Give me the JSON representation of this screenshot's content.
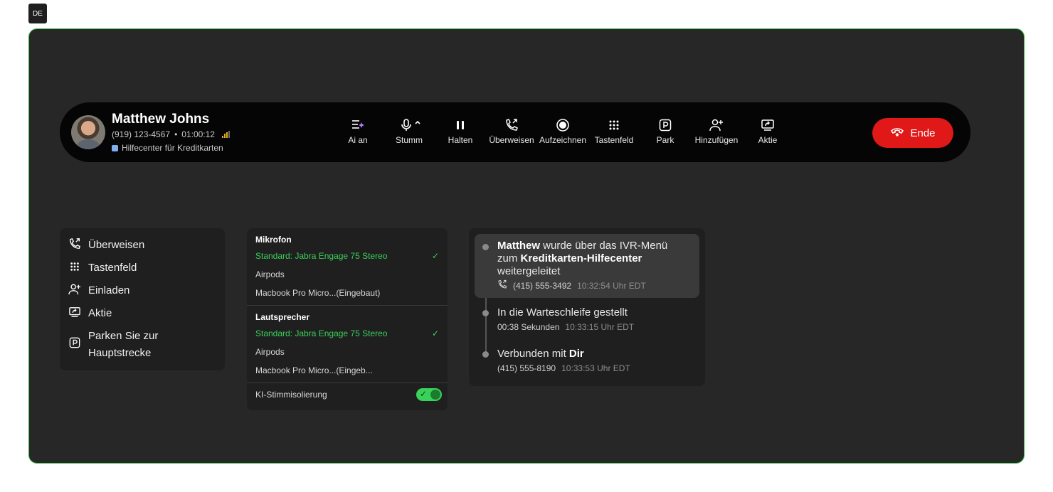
{
  "lang_badge": "DE",
  "caller": {
    "name": "Matthew Johns",
    "phone": "(919) 123-4567",
    "separator": "•",
    "duration": "01:00:12",
    "queue": "Hilfecenter für Kreditkarten"
  },
  "controls": [
    {
      "label": "Ai an",
      "icon": "ai-icon"
    },
    {
      "label": "Stumm",
      "icon": "microphone-icon"
    },
    {
      "label": "Halten",
      "icon": "pause-icon"
    },
    {
      "label": "Überweisen",
      "icon": "transfer-icon"
    },
    {
      "label": "Aufzeichnen",
      "icon": "record-icon"
    },
    {
      "label": "Tastenfeld",
      "icon": "keypad-icon"
    },
    {
      "label": "Park",
      "icon": "park-icon"
    },
    {
      "label": "Hinzufügen",
      "icon": "add-person-icon"
    },
    {
      "label": "Aktie",
      "icon": "share-screen-icon"
    }
  ],
  "end_button": {
    "label": "Ende",
    "color": "#e01818"
  },
  "menu": {
    "items": [
      {
        "label": "Überweisen",
        "icon": "transfer-icon"
      },
      {
        "label": "Tastenfeld",
        "icon": "keypad-icon"
      },
      {
        "label": "Einladen",
        "icon": "add-person-icon"
      },
      {
        "label": "Aktie",
        "icon": "share-screen-icon"
      },
      {
        "label_line1": "Parken Sie zur",
        "label_line2": "Hauptstrecke",
        "icon": "park-icon"
      }
    ]
  },
  "audio": {
    "mic_header": "Mikrofon",
    "mic_options": [
      "Standard: Jabra Engage 75 Stereo",
      "Airpods",
      "Macbook Pro Micro...(Eingebaut)"
    ],
    "speaker_header": "Lautsprecher",
    "speaker_options": [
      "Standard: Jabra Engage 75 Stereo",
      "Airpods",
      "Macbook Pro Micro...(Eingeb..."
    ],
    "isolation_label": "KI-Stimmisolierung",
    "isolation_on": true,
    "selected_color": "#3ad15a"
  },
  "timeline": {
    "event1": {
      "bold1": "Matthew",
      "text1": " wurde über das IVR-Menü zum ",
      "bold2": "Kreditkarten-Hilfecenter",
      "text2": " weitergeleitet",
      "phone": "(415) 555-3492",
      "time": "10:32:54 Uhr EDT"
    },
    "event2": {
      "text": "In die Warteschleife gestellt",
      "detail": "00:38 Sekunden",
      "time": "10:33:15 Uhr EDT"
    },
    "event3": {
      "text": "Verbunden mit ",
      "bold": "Dir",
      "detail": "(415) 555-8190",
      "time": "10:33:53 Uhr EDT"
    }
  }
}
